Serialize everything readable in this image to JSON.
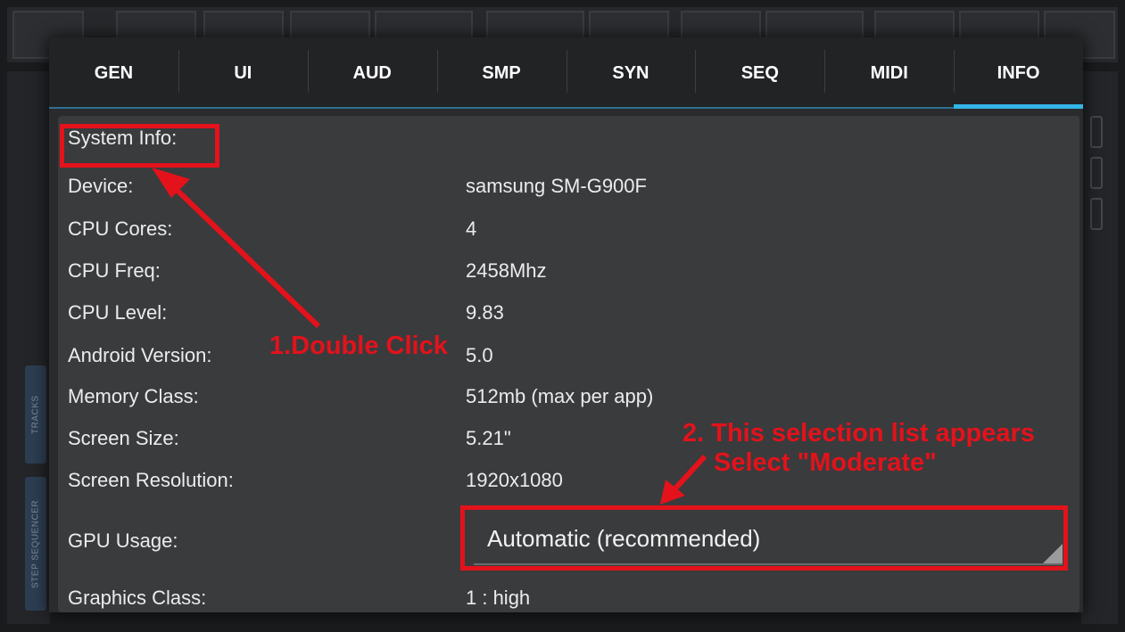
{
  "background": {
    "side_tabs": [
      "TRACKS",
      "STEP SEQUENCER"
    ]
  },
  "dialog": {
    "tabs": [
      {
        "label": "GEN",
        "active": false
      },
      {
        "label": "UI",
        "active": false
      },
      {
        "label": "AUD",
        "active": false
      },
      {
        "label": "SMP",
        "active": false
      },
      {
        "label": "SYN",
        "active": false
      },
      {
        "label": "SEQ",
        "active": false
      },
      {
        "label": "MIDI",
        "active": false
      },
      {
        "label": "INFO",
        "active": true
      }
    ],
    "section_title": "System Info:",
    "rows": [
      {
        "label": "Device:",
        "value": "samsung SM-G900F"
      },
      {
        "label": "CPU Cores:",
        "value": "4"
      },
      {
        "label": "CPU Freq:",
        "value": "2458Mhz"
      },
      {
        "label": "CPU Level:",
        "value": "9.83"
      },
      {
        "label": "Android Version:",
        "value": "5.0"
      },
      {
        "label": "Memory Class:",
        "value": "512mb (max per app)"
      },
      {
        "label": "Screen Size:",
        "value": "5.21\""
      },
      {
        "label": "Screen Resolution:",
        "value": "1920x1080"
      }
    ],
    "gpu_usage": {
      "label": "GPU Usage:",
      "selected": "Automatic (recommended)"
    },
    "graphics_class": {
      "label": "Graphics Class:",
      "value": "1 : high"
    }
  },
  "annotations": {
    "step1": "1.Double Click",
    "step2_line1": "2. This selection list appears",
    "step2_line2": "Select \"Moderate\"",
    "color": "#e3121b"
  },
  "colors": {
    "accent": "#33b5e5",
    "dialog_bg": "#2a2b2d",
    "content_bg": "#3a3b3d"
  }
}
